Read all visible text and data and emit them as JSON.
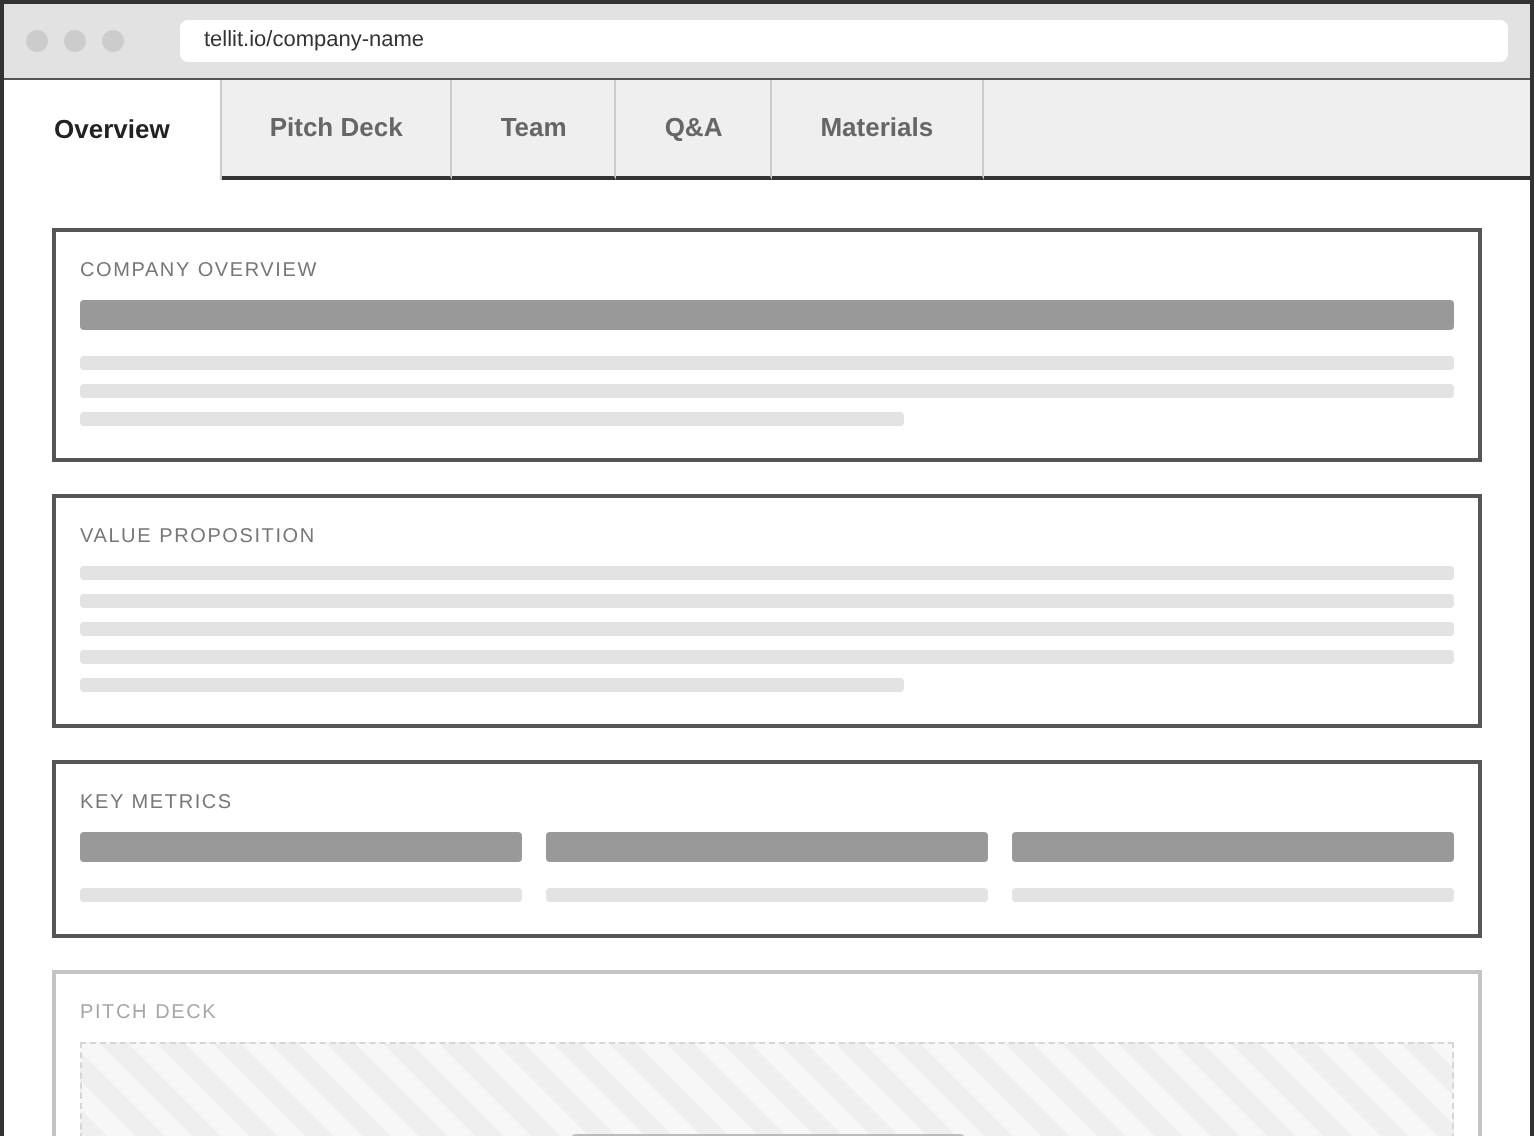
{
  "browser": {
    "url": "tellit.io/company-name"
  },
  "tabs": [
    {
      "label": "Overview",
      "selected": true
    },
    {
      "label": "Pitch Deck",
      "selected": false
    },
    {
      "label": "Team",
      "selected": false
    },
    {
      "label": "Q&A",
      "selected": false
    },
    {
      "label": "Materials",
      "selected": false
    }
  ],
  "sections": [
    {
      "title": "COMPANY OVERVIEW",
      "kind": "summary",
      "disabled": false
    },
    {
      "title": "VALUE PROPOSITION",
      "kind": "paragraph",
      "disabled": false
    },
    {
      "title": "KEY METRICS",
      "kind": "metrics",
      "disabled": false
    },
    {
      "title": "PITCH DECK",
      "kind": "deck",
      "disabled": true
    }
  ]
}
